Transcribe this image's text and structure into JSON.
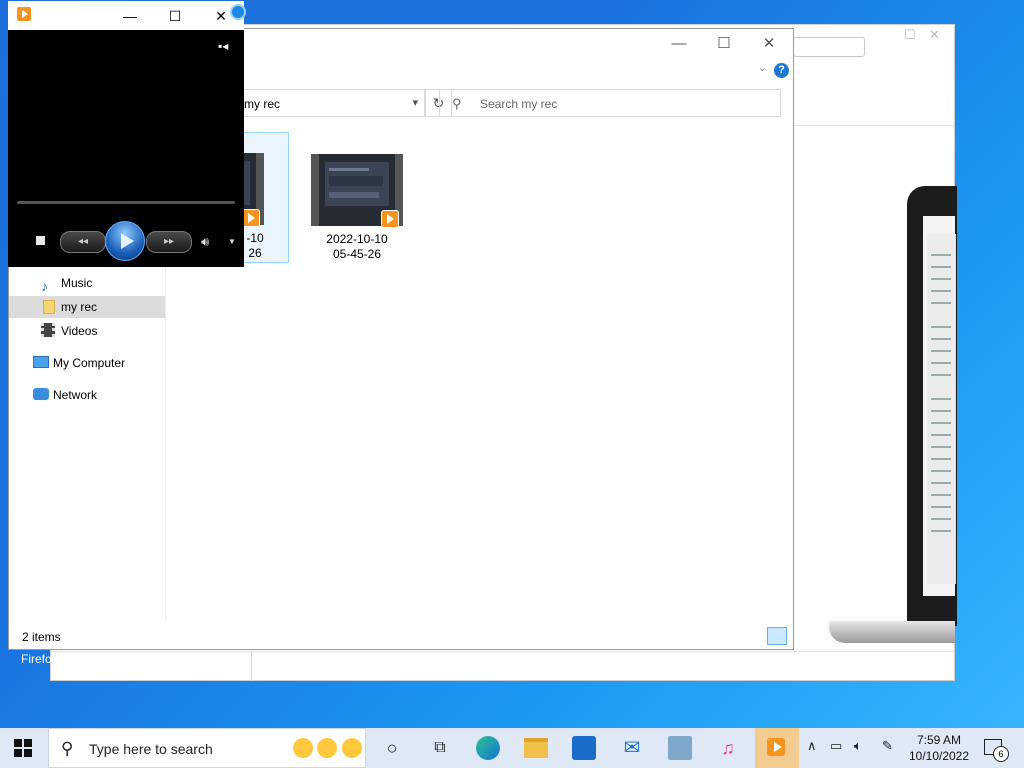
{
  "desktop": {
    "firefox_label": "Firefo"
  },
  "explorer": {
    "address": "my rec",
    "search_placeholder": "Search my rec",
    "help_label": "?",
    "nav": [
      {
        "label": "Music",
        "icon": "music-icon"
      },
      {
        "label": "my rec",
        "icon": "folder-icon",
        "selected": true
      },
      {
        "label": "Videos",
        "icon": "videos-icon"
      },
      {
        "label": "My Computer",
        "icon": "computer-icon"
      },
      {
        "label": "Network",
        "icon": "network-icon"
      }
    ],
    "files": [
      {
        "name_line1": "-10",
        "name_line2": "26",
        "selected": true
      },
      {
        "name_line1": "2022-10-10",
        "name_line2": "05-45-26"
      }
    ],
    "status": "2 items"
  },
  "player": {
    "title_icon": "media-player-icon",
    "controls": [
      "stop",
      "previous",
      "play",
      "next",
      "volume"
    ]
  },
  "taskbar": {
    "search_placeholder": "Type here to search",
    "time": "7:59 AM",
    "date": "10/10/2022",
    "notification_count": "6"
  }
}
